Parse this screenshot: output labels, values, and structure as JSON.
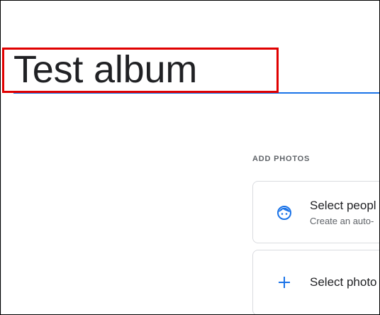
{
  "album": {
    "title": "Test album"
  },
  "add_photos": {
    "section_label": "ADD PHOTOS",
    "options": [
      {
        "title": "Select peopl",
        "subtitle": "Create an auto-",
        "icon": "face-icon"
      },
      {
        "title": "Select photo",
        "icon": "plus-icon"
      }
    ]
  },
  "colors": {
    "accent": "#1a73e8",
    "highlight": "#e00000",
    "text": "#202124",
    "muted": "#5f6368"
  }
}
